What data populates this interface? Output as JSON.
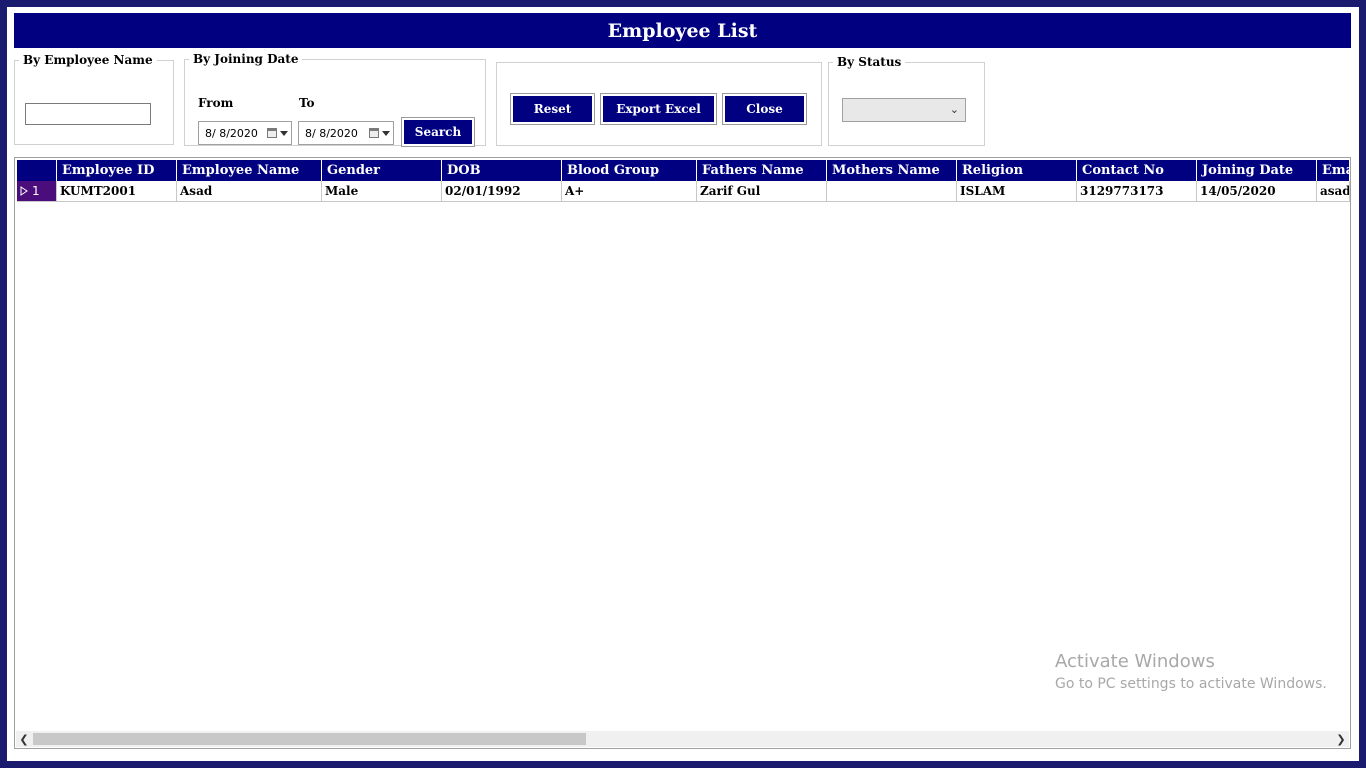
{
  "title": "Employee List",
  "filters": {
    "by_name": {
      "legend": "By Employee Name",
      "value": ""
    },
    "by_joining_date": {
      "legend": "By Joining Date",
      "from_label": "From",
      "to_label": "To",
      "from_value": "8/  8/2020",
      "to_value": "8/  8/2020",
      "search_label": "Search"
    },
    "actions": {
      "reset_label": "Reset",
      "export_label": "Export Excel",
      "close_label": "Close"
    },
    "by_status": {
      "legend": "By Status",
      "selected": ""
    }
  },
  "grid": {
    "columns": [
      "Employee ID",
      "Employee Name",
      "Gender",
      "DOB",
      "Blood Group",
      "Fathers Name",
      "Mothers Name",
      "Religion",
      "Contact No",
      "Joining Date",
      "Emai"
    ],
    "rows": [
      {
        "row_number": "1",
        "cells": [
          "KUMT2001",
          "Asad",
          "Male",
          "02/01/1992",
          "A+",
          "Zarif Gul",
          "",
          "ISLAM",
          "3129773173",
          "14/05/2020",
          "asad.s"
        ]
      }
    ]
  },
  "watermark": {
    "line1": "Activate Windows",
    "line2": "Go to PC settings to activate Windows."
  },
  "colors": {
    "header_bg": "#000080",
    "outer_border": "#1a1a6e",
    "row_header": "#4b0c7c"
  }
}
